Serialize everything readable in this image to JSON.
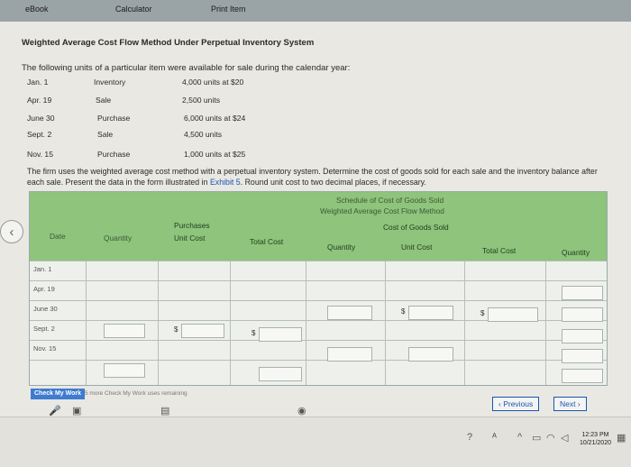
{
  "tabs": [
    "eBook",
    "Calculator",
    "Print Item"
  ],
  "title": "Weighted Average Cost Flow Method Under Perpetual Inventory System",
  "intro": "The following units of a particular item were available for sale during the calendar year:",
  "inventory_rows": [
    {
      "date": "Jan. 1",
      "type": "Inventory",
      "detail": "4,000 units at $20"
    },
    {
      "date": "Apr. 19",
      "type": "Sale",
      "detail": "2,500 units"
    },
    {
      "date": "June 30",
      "type": "Purchase",
      "detail": "6,000 units at $24"
    },
    {
      "date": "Sept. 2",
      "type": "Sale",
      "detail": "4,500 units"
    },
    {
      "date": "Nov. 15",
      "type": "Purchase",
      "detail": "1,000 units at $25"
    }
  ],
  "instructions": {
    "text1": "The firm uses the weighted average cost method with a perpetual inventory system. Determine the cost of goods sold for each sale and the inventory balance after each sale. Present the data in the form illustrated in ",
    "link": "Exhibit 5",
    "text2": ". Round unit cost to two decimal places, if necessary."
  },
  "table": {
    "schedule_title": "Schedule of Cost of Goods Sold",
    "method_title": "Weighted Average Cost Flow Method",
    "group_purchases": "Purchases",
    "group_cogs": "Cost of Goods Sold",
    "headers": {
      "date": "Date",
      "p_quantity": "Quantity",
      "p_unit_cost": "Unit Cost",
      "p_total_cost": "Total Cost",
      "c_quantity": "Quantity",
      "c_unit_cost": "Unit Cost",
      "c_total_cost": "Total Cost",
      "i_quantity": "Quantity"
    },
    "rows": [
      "Jan. 1",
      "Apr. 19",
      "June 30",
      "Sept. 2",
      "Nov. 15"
    ],
    "dollar_sign": "$"
  },
  "check_button": "Check My Work",
  "check_note": "5 more Check My Work uses remaining",
  "nav": {
    "previous": "Previous",
    "next": "Next"
  },
  "clock": {
    "time": "12:23 PM",
    "date": "10/21/2020"
  },
  "colors": {
    "header_green": "#8ec47b",
    "link_blue": "#1a56b0"
  }
}
